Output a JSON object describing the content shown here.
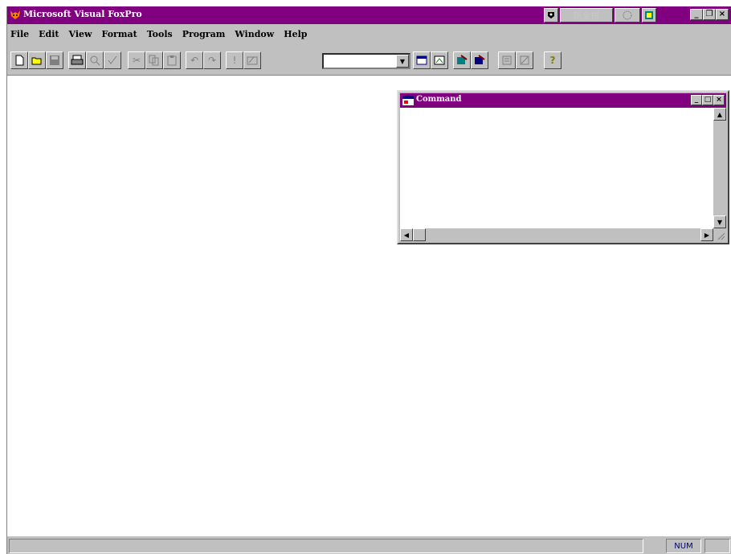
{
  "app": {
    "title": "Microsoft Visual FoxPro",
    "ime": {
      "input_method_label": "新全拼"
    }
  },
  "menu": {
    "items": [
      "File",
      "Edit",
      "View",
      "Format",
      "Tools",
      "Program",
      "Window",
      "Help"
    ]
  },
  "toolbar": {
    "icons": [
      "new-file-icon",
      "open-file-icon",
      "save-icon",
      "print-icon",
      "print-preview-icon",
      "spell-check-icon",
      "cut-icon",
      "copy-icon",
      "paste-icon",
      "undo-icon",
      "redo-icon",
      "run-icon",
      "modify-form-icon",
      "database-combo",
      "command-window-icon",
      "data-session-icon",
      "form-wizard-icon",
      "report-wizard-icon",
      "autoform-icon",
      "autoreport-icon",
      "help-icon"
    ],
    "database_combo_value": ""
  },
  "command_window": {
    "title": "Command",
    "content": ""
  },
  "statusbar": {
    "message": "",
    "num_indicator": "NUM"
  },
  "colors": {
    "titlebar": "#800080",
    "face": "#c0c0c0"
  }
}
